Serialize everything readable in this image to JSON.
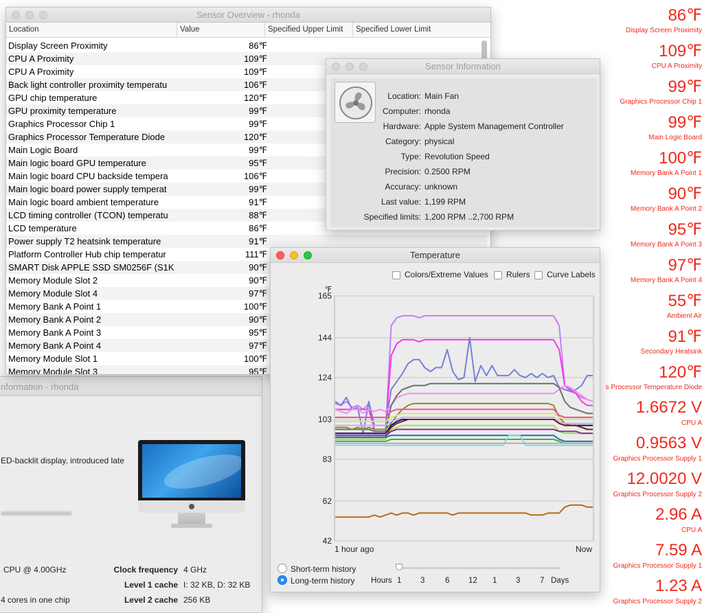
{
  "overview": {
    "title": "Sensor Overview - rhonda",
    "columns": [
      "Location",
      "Value",
      "Specified Upper Limit",
      "Specified Lower Limit"
    ],
    "rows": [
      {
        "location": "Display Screen Proximity",
        "value": "86℉"
      },
      {
        "location": "CPU A Proximity",
        "value": "109℉"
      },
      {
        "location": "CPU A Proximity",
        "value": "109℉"
      },
      {
        "location": "Back light controller proximity temperatu",
        "value": "106℉"
      },
      {
        "location": "GPU chip temperature",
        "value": "120℉"
      },
      {
        "location": "GPU proximity temperature",
        "value": "99℉"
      },
      {
        "location": "Graphics Processor Chip 1",
        "value": "99℉"
      },
      {
        "location": "Graphics Processor Temperature Diode",
        "value": "120℉"
      },
      {
        "location": "Main Logic Board",
        "value": "99℉"
      },
      {
        "location": "Main logic board GPU temperature",
        "value": "95℉"
      },
      {
        "location": "Main logic board CPU backside tempera",
        "value": "106℉"
      },
      {
        "location": "Main logic board power supply temperat",
        "value": "99℉"
      },
      {
        "location": "Main logic board ambient temperature",
        "value": "91℉"
      },
      {
        "location": "LCD timing controller (TCON) temperatu",
        "value": "88℉"
      },
      {
        "location": "LCD temperature",
        "value": "86℉"
      },
      {
        "location": "Power supply T2 heatsink temperature",
        "value": "91℉"
      },
      {
        "location": "Platform Controller Hub chip temperatur",
        "value": "111℉"
      },
      {
        "location": "SMART Disk APPLE SSD SM0256F (S1K",
        "value": "90℉"
      },
      {
        "location": "Memory Module Slot 2",
        "value": "90℉"
      },
      {
        "location": "Memory Module Slot 4",
        "value": "97℉"
      },
      {
        "location": "Memory Bank A Point 1",
        "value": "100℉"
      },
      {
        "location": "Memory Bank A Point 2",
        "value": "90℉"
      },
      {
        "location": "Memory Bank A Point 3",
        "value": "95℉"
      },
      {
        "location": "Memory Bank A Point 4",
        "value": "97℉"
      },
      {
        "location": "Memory Module Slot 1",
        "value": "100℉"
      },
      {
        "location": "Memory Module Slot 3",
        "value": "95℉"
      }
    ]
  },
  "info": {
    "title": "Sensor Information",
    "fields": [
      {
        "label": "Location:",
        "value": "Main Fan"
      },
      {
        "label": "Computer:",
        "value": "rhonda"
      },
      {
        "label": "Hardware:",
        "value": "Apple System Management Controller"
      },
      {
        "label": "Category:",
        "value": "physical"
      },
      {
        "label": "Type:",
        "value": "Revolution Speed"
      },
      {
        "label": "Precision:",
        "value": "0.2500 RPM"
      },
      {
        "label": "Accuracy:",
        "value": "unknown"
      },
      {
        "label": "Last value:",
        "value": "1,199 RPM"
      },
      {
        "label": "Specified limits:",
        "value": "1,200 RPM ..2,700 RPM"
      }
    ]
  },
  "sysinfo": {
    "title": "nformation - rhonda",
    "description": "ED-backlit display, introduced late",
    "cpu": "CPU @ 4.00GHz",
    "cores": "4 cores in one chip",
    "clock_label": "Clock frequency",
    "clock_value": "4 GHz",
    "l1_label": "Level 1 cache",
    "l1_value": "I: 32 KB, D: 32 KB",
    "l2_label": "Level 2 cache",
    "l2_value": "256 KB"
  },
  "temperature": {
    "title": "Temperature",
    "options": [
      "Colors/Extreme Values",
      "Rulers",
      "Curve Labels"
    ],
    "short_term": "Short-term history",
    "long_term": "Long-term history",
    "selected": "long-term",
    "scale_label": "Hours",
    "scale_ticks": [
      "1",
      "3",
      "6",
      "12",
      "1",
      "3",
      "7",
      "Days"
    ],
    "x_start": "1 hour  ago",
    "x_end": "Now"
  },
  "chart_data": {
    "type": "line",
    "ylabel": "℉",
    "y_ticks": [
      42,
      62,
      83,
      103,
      124,
      144,
      165
    ],
    "ylim": [
      42,
      165
    ],
    "grid": true,
    "series": [
      {
        "color": "#c77ef5",
        "values": [
          111,
          110,
          112,
          109,
          110,
          108,
          111,
          97,
          97,
          97,
          150,
          154,
          155,
          155,
          155,
          154,
          155,
          155,
          155,
          155,
          155,
          155,
          155,
          155,
          155,
          155,
          155,
          155,
          155,
          155,
          155,
          155,
          155,
          155,
          155,
          155,
          155,
          155,
          155,
          155,
          150,
          120,
          117,
          116,
          114,
          113,
          112
        ]
      },
      {
        "color": "#f539e5",
        "values": [
          108,
          108,
          108,
          108,
          108,
          108,
          108,
          98,
          98,
          98,
          135,
          141,
          143,
          143,
          143,
          142,
          143,
          143,
          143,
          143,
          143,
          143,
          143,
          143,
          143,
          143,
          143,
          143,
          143,
          143,
          143,
          143,
          143,
          143,
          143,
          143,
          143,
          143,
          143,
          143,
          138,
          120,
          118,
          116,
          112,
          110,
          110
        ]
      },
      {
        "color": "#7780d8",
        "values": [
          112,
          110,
          114,
          108,
          109,
          96,
          112,
          100,
          100,
          100,
          118,
          122,
          126,
          131,
          133,
          133,
          129,
          127,
          129,
          129,
          138,
          127,
          123,
          124,
          144,
          122,
          130,
          125,
          130,
          125,
          125,
          125,
          128,
          125,
          124,
          126,
          124,
          126,
          124,
          125,
          119,
          118,
          117,
          118,
          120,
          125,
          125
        ]
      },
      {
        "color": "#f08ff0",
        "values": [
          108,
          107,
          106,
          108,
          108,
          106,
          108,
          107,
          108,
          107,
          110,
          114,
          115,
          116,
          116,
          116,
          116,
          116,
          116,
          116,
          116,
          116,
          116,
          116,
          116,
          116,
          116,
          116,
          116,
          116,
          116,
          116,
          116,
          116,
          116,
          116,
          116,
          116,
          116,
          116,
          118,
          120,
          119,
          117,
          115,
          113,
          112
        ]
      },
      {
        "color": "#6f6f6f",
        "values": [
          98,
          98,
          98,
          98,
          98,
          98,
          98,
          97,
          97,
          97,
          110,
          115,
          118,
          119,
          120,
          120,
          120,
          121,
          121,
          121,
          121,
          121,
          121,
          121,
          121,
          121,
          121,
          121,
          121,
          121,
          121,
          121,
          121,
          121,
          121,
          121,
          121,
          121,
          121,
          121,
          119,
          112,
          109,
          108,
          107,
          106,
          106
        ]
      },
      {
        "color": "#8c8c24",
        "values": [
          99,
          99,
          99,
          98,
          99,
          98,
          99,
          98,
          98,
          98,
          101,
          105,
          108,
          110,
          111,
          111,
          111,
          111,
          111,
          111,
          111,
          111,
          111,
          111,
          111,
          111,
          111,
          111,
          111,
          111,
          111,
          111,
          111,
          111,
          111,
          111,
          111,
          111,
          111,
          110,
          104,
          101,
          100,
          100,
          99,
          98,
          98
        ]
      },
      {
        "color": "#f0509a",
        "values": [
          104,
          104,
          104,
          104,
          104,
          104,
          104,
          104,
          104,
          104,
          107,
          108,
          108,
          108,
          108,
          108,
          108,
          108,
          108,
          108,
          108,
          108,
          108,
          108,
          108,
          108,
          108,
          108,
          108,
          108,
          108,
          108,
          108,
          108,
          108,
          108,
          108,
          108,
          108,
          108,
          105,
          104,
          104,
          104,
          104,
          104,
          104
        ]
      },
      {
        "color": "#e0e077",
        "values": [
          102,
          102,
          102,
          102,
          102,
          102,
          102,
          102,
          102,
          102,
          104,
          105,
          106,
          106,
          106,
          106,
          106,
          106,
          106,
          106,
          106,
          106,
          106,
          106,
          106,
          106,
          106,
          106,
          106,
          106,
          106,
          106,
          106,
          106,
          106,
          106,
          106,
          106,
          106,
          106,
          104,
          103,
          103,
          103,
          103,
          103,
          103
        ]
      },
      {
        "color": "#c2b2ea",
        "values": [
          100,
          100,
          100,
          100,
          100,
          100,
          100,
          100,
          100,
          100,
          102,
          103,
          104,
          104,
          104,
          104,
          104,
          104,
          104,
          104,
          104,
          104,
          104,
          104,
          104,
          104,
          104,
          104,
          104,
          104,
          104,
          104,
          104,
          104,
          104,
          104,
          104,
          104,
          104,
          104,
          102,
          101,
          101,
          101,
          101,
          101,
          101
        ]
      },
      {
        "color": "#0d0d7a",
        "values": [
          96,
          96,
          96,
          96,
          96,
          96,
          96,
          96,
          96,
          96,
          100,
          102,
          103,
          103,
          103,
          103,
          103,
          103,
          103,
          103,
          103,
          103,
          103,
          103,
          103,
          103,
          103,
          103,
          103,
          103,
          103,
          103,
          103,
          103,
          103,
          103,
          103,
          103,
          103,
          103,
          101,
          100,
          100,
          100,
          100,
          100,
          100
        ]
      },
      {
        "color": "#7a1f1f",
        "values": [
          94,
          94,
          94,
          94,
          94,
          94,
          94,
          94,
          94,
          94,
          99,
          101,
          102,
          103,
          103,
          103,
          103,
          103,
          103,
          103,
          103,
          103,
          103,
          103,
          103,
          103,
          103,
          103,
          103,
          103,
          103,
          103,
          103,
          103,
          103,
          103,
          103,
          103,
          103,
          103,
          101,
          100,
          100,
          100,
          99,
          98,
          98
        ]
      },
      {
        "color": "#91ea4c",
        "values": [
          93,
          93,
          93,
          93,
          93,
          93,
          93,
          93,
          93,
          93,
          98,
          99,
          100,
          100,
          100,
          100,
          100,
          100,
          100,
          100,
          100,
          100,
          100,
          100,
          100,
          100,
          100,
          100,
          100,
          100,
          100,
          100,
          100,
          100,
          100,
          100,
          100,
          100,
          100,
          100,
          97,
          96,
          96,
          96,
          96,
          96,
          96
        ]
      },
      {
        "color": "#8b2d8b",
        "values": [
          95,
          95,
          95,
          95,
          95,
          95,
          95,
          95,
          95,
          95,
          97,
          98,
          98,
          98,
          98,
          98,
          98,
          98,
          98,
          98,
          98,
          98,
          98,
          98,
          98,
          98,
          98,
          98,
          98,
          98,
          98,
          98,
          98,
          98,
          98,
          98,
          98,
          98,
          98,
          98,
          97,
          97,
          97,
          97,
          96,
          96,
          96
        ]
      },
      {
        "color": "#2a6ab8",
        "values": [
          94,
          94,
          94,
          94,
          94,
          94,
          94,
          94,
          94,
          94,
          95,
          95,
          95,
          95,
          95,
          95,
          95,
          95,
          95,
          95,
          95,
          95,
          95,
          95,
          95,
          95,
          95,
          95,
          95,
          95,
          95,
          95,
          95,
          95,
          95,
          95,
          95,
          95,
          95,
          95,
          93,
          92,
          92,
          92,
          92,
          92,
          92
        ]
      },
      {
        "color": "#36b836",
        "values": [
          92,
          92,
          92,
          92,
          92,
          92,
          92,
          92,
          92,
          92,
          93,
          93,
          93,
          93,
          93,
          93,
          93,
          93,
          93,
          93,
          93,
          93,
          93,
          93,
          93,
          93,
          93,
          93,
          93,
          93,
          93,
          93,
          93,
          93,
          93,
          93,
          93,
          93,
          93,
          93,
          92,
          91,
          91,
          91,
          91,
          91,
          91
        ]
      },
      {
        "color": "#88d5ea",
        "values": [
          90,
          90,
          90,
          90,
          90,
          90,
          90,
          90,
          90,
          90,
          90,
          90,
          90,
          90,
          90,
          90,
          90,
          90,
          90,
          90,
          90,
          90,
          90,
          90,
          90,
          90,
          90,
          90,
          90,
          90,
          90,
          95,
          95,
          95,
          90,
          90,
          90,
          90,
          90,
          90,
          90,
          90,
          90,
          90,
          90,
          90,
          90
        ]
      },
      {
        "color": "#b0b0b0",
        "values": [
          91,
          91,
          91,
          91,
          91,
          91,
          91,
          91,
          91,
          91,
          91,
          91,
          91,
          91,
          91,
          91,
          91,
          91,
          91,
          91,
          91,
          91,
          91,
          91,
          91,
          91,
          91,
          91,
          91,
          91,
          91,
          91,
          91,
          91,
          91,
          91,
          91,
          91,
          91,
          91,
          91,
          91,
          91,
          91,
          91,
          91,
          91
        ]
      },
      {
        "color": "#b86a1c",
        "values": [
          54,
          54,
          54,
          54,
          54,
          54,
          54,
          55,
          54,
          55,
          56,
          55,
          56,
          56,
          55,
          56,
          56,
          56,
          56,
          56,
          56,
          55,
          56,
          56,
          56,
          56,
          56,
          56,
          56,
          56,
          56,
          56,
          56,
          56,
          56,
          55,
          55,
          55,
          56,
          56,
          56,
          59,
          60,
          60,
          60,
          59,
          59
        ]
      }
    ]
  },
  "readings": [
    {
      "value": "86℉",
      "label": "Display Screen Proximity"
    },
    {
      "value": "109℉",
      "label": "CPU A Proximity"
    },
    {
      "value": "99℉",
      "label": "Graphics Processor Chip 1"
    },
    {
      "value": "99℉",
      "label": "Main Logic Board"
    },
    {
      "value": "100℉",
      "label": "Memory Bank A Point 1"
    },
    {
      "value": "90℉",
      "label": "Memory Bank A Point 2"
    },
    {
      "value": "95℉",
      "label": "Memory Bank A Point 3"
    },
    {
      "value": "97℉",
      "label": "Memory Bank A Point 4"
    },
    {
      "value": "55℉",
      "label": "Ambient Air"
    },
    {
      "value": "91℉",
      "label": "Secondary Heatsink"
    },
    {
      "value": "120℉",
      "label": "s Processor Temperature Diode"
    },
    {
      "value": "1.6672 V",
      "label": "CPU A"
    },
    {
      "value": "0.9563 V",
      "label": "Graphics Processor Supply 1"
    },
    {
      "value": "12.0020 V",
      "label": "Graphics Processor Supply 2"
    },
    {
      "value": "2.96 A",
      "label": "CPU A"
    },
    {
      "value": "7.59 A",
      "label": "Graphics Processor Supply 1"
    },
    {
      "value": "1.23 A",
      "label": "Graphics Processor Supply 2"
    }
  ]
}
